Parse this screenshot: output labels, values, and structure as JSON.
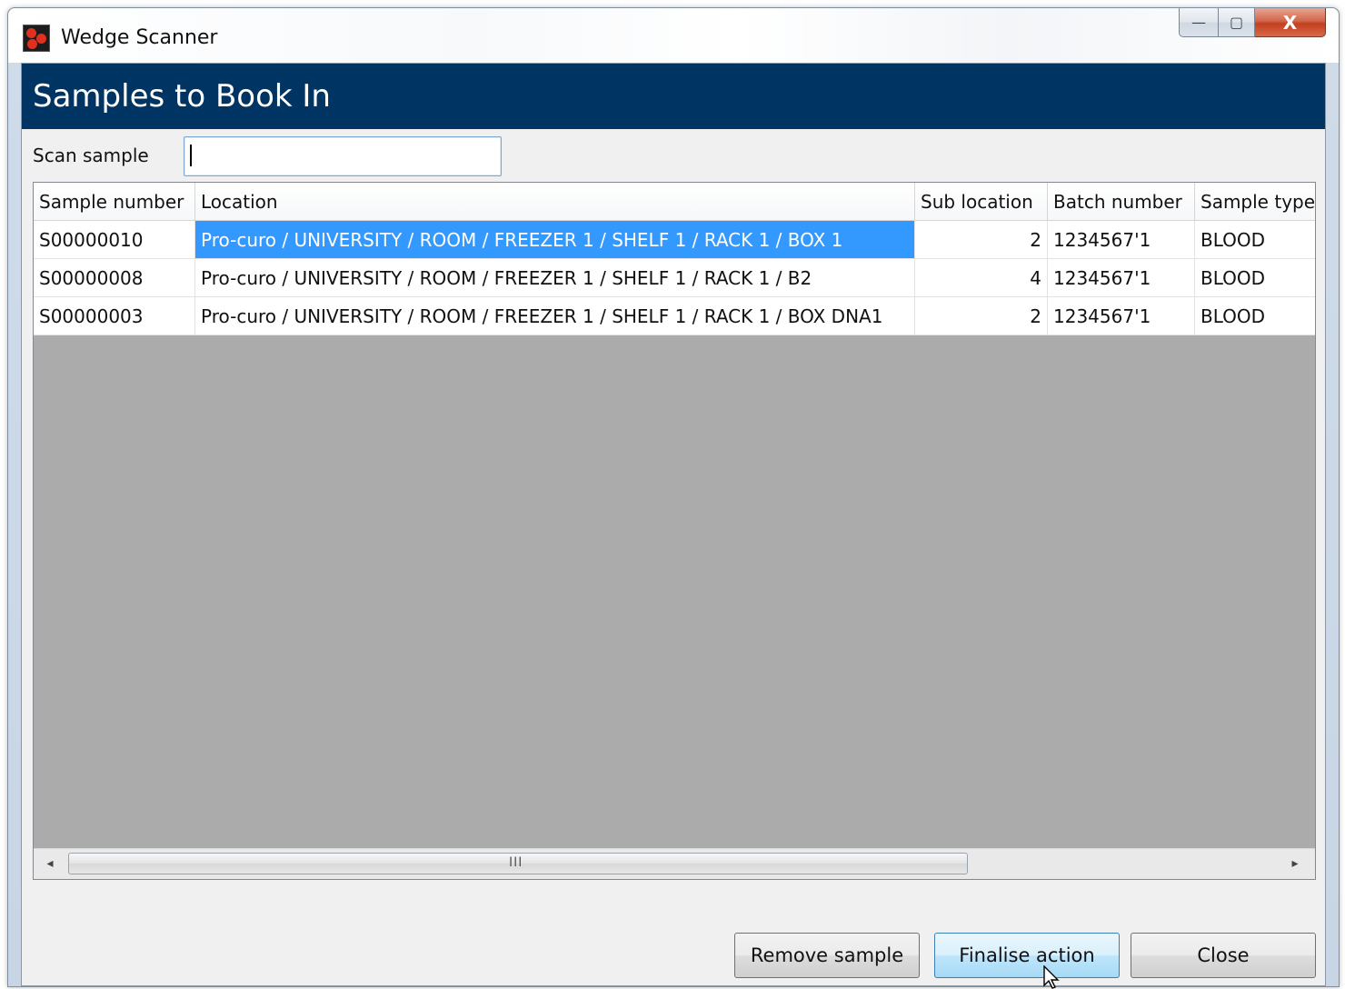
{
  "window": {
    "title": "Wedge Scanner",
    "controls": {
      "minimize": "—",
      "maximize": "▢",
      "close": "X"
    }
  },
  "header": {
    "title": "Samples to Book In"
  },
  "scan": {
    "label": "Scan sample",
    "value": ""
  },
  "table": {
    "columns": [
      "Sample number",
      "Location",
      "Sub location",
      "Batch number",
      "Sample type"
    ],
    "rows": [
      {
        "sample_number": "S00000010",
        "location": "Pro-curo / UNIVERSITY / ROOM / FREEZER 1 / SHELF 1 / RACK 1 / BOX 1",
        "sub_location": "2",
        "batch_number": "1234567'1",
        "sample_type": "BLOOD",
        "selected_cell": "location"
      },
      {
        "sample_number": "S00000008",
        "location": "Pro-curo / UNIVERSITY / ROOM / FREEZER 1 / SHELF 1 / RACK 1 / B2",
        "sub_location": "4",
        "batch_number": "1234567'1",
        "sample_type": "BLOOD"
      },
      {
        "sample_number": "S00000003",
        "location": "Pro-curo / UNIVERSITY / ROOM / FREEZER 1 / SHELF 1 / RACK 1 / BOX DNA1",
        "sub_location": "2",
        "batch_number": "1234567'1",
        "sample_type": "BLOOD"
      }
    ],
    "scrollbar": {
      "left_arrow": "◂",
      "right_arrow": "▸",
      "grip": "III"
    }
  },
  "buttons": {
    "remove": "Remove sample",
    "finalise": "Finalise action",
    "close": "Close"
  },
  "colors": {
    "header_band": "#003463",
    "selection": "#3399ff",
    "empty_grid": "#ababab"
  }
}
